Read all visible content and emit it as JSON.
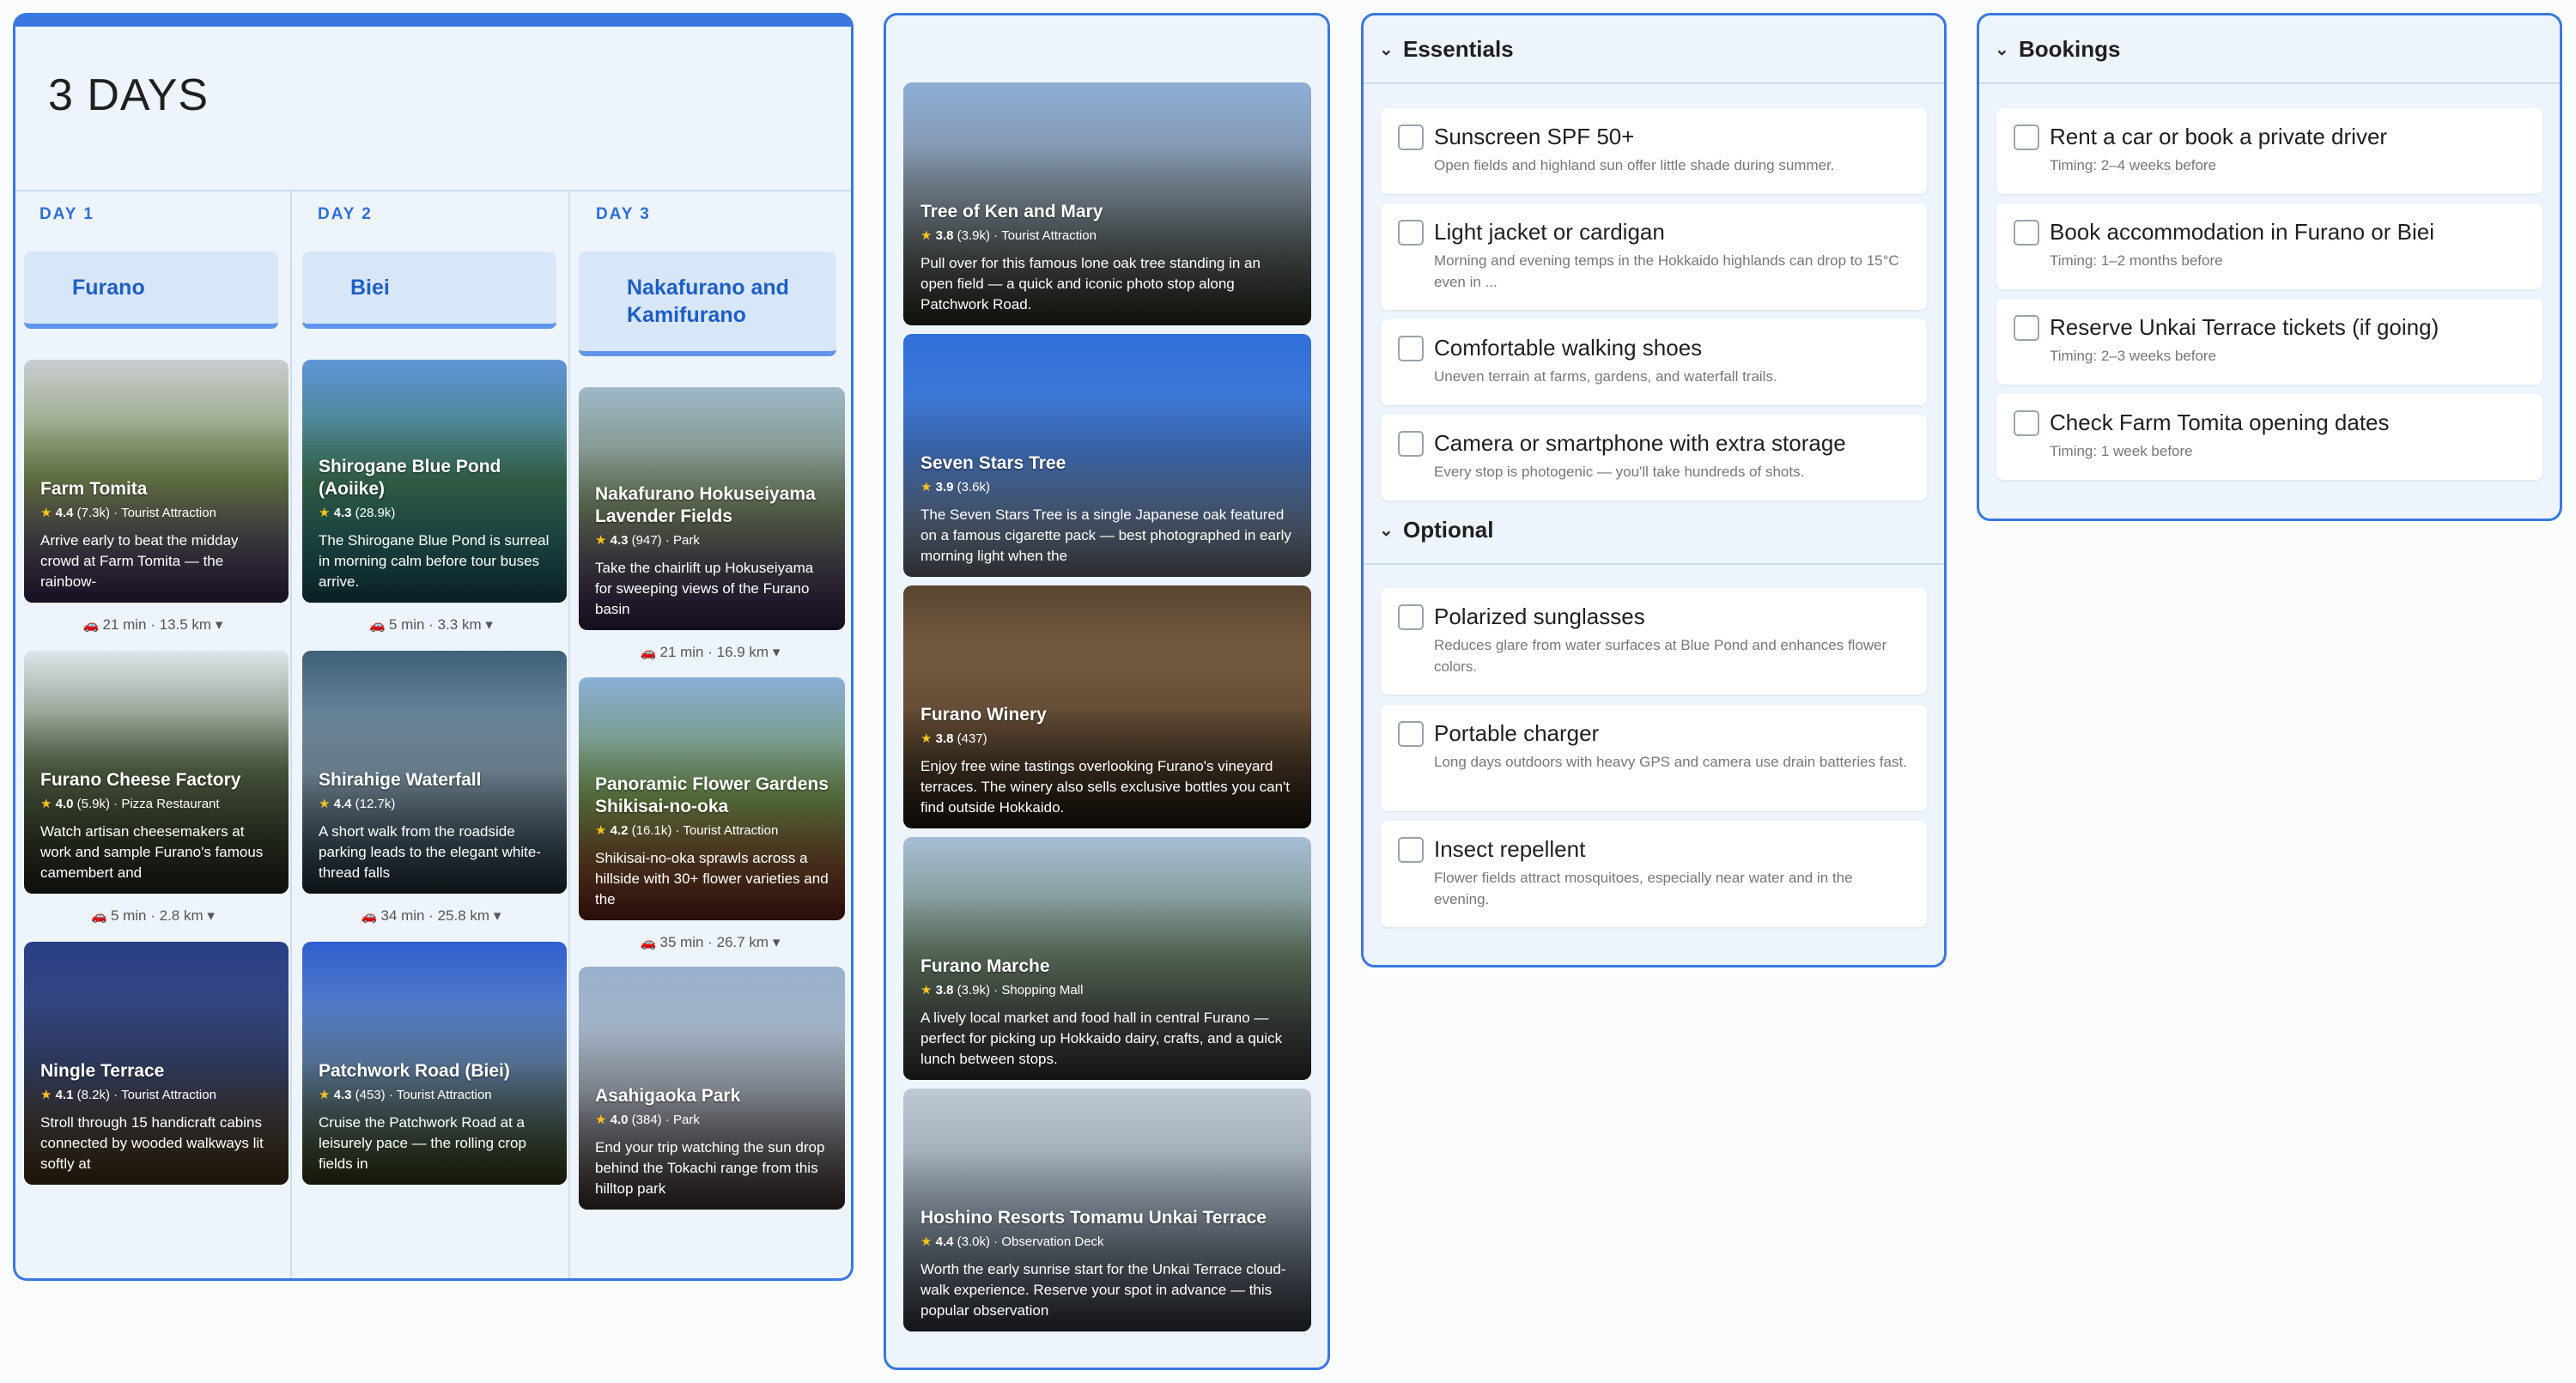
{
  "itinerary": {
    "title": "3 DAYS",
    "days": [
      {
        "label": "DAY 1",
        "location": "Furano",
        "stops": [
          {
            "name": "Farm Tomita",
            "rating": "4.4",
            "reviews": "(7.3k)",
            "category": "Tourist Attraction",
            "description": "Arrive early to beat the midday crowd at Farm Tomita — the rainbow-",
            "colors": [
              "#c8cdd2",
              "#7c8f55",
              "#6a4c9a"
            ]
          },
          {
            "name": "Furano Cheese Factory",
            "rating": "4.0",
            "reviews": "(5.9k)",
            "category": "Pizza Restaurant",
            "description": "Watch artisan cheesemakers at work and sample Furano's famous camembert and",
            "colors": [
              "#dfe5ea",
              "#5a6a4a",
              "#39422f"
            ]
          },
          {
            "name": "Ningle Terrace",
            "rating": "4.1",
            "reviews": "(8.2k)",
            "category": "Tourist Attraction",
            "description": "Stroll through 15 handicraft cabins connected by wooded walkways lit softly at",
            "colors": [
              "#2a3f86",
              "#3b4a7a",
              "#7a5a2a"
            ]
          }
        ],
        "travel": [
          "21 min · 13.5 km",
          "5 min · 2.8 km"
        ]
      },
      {
        "label": "DAY 2",
        "location": "Biei",
        "stops": [
          {
            "name": "Shirogane Blue Pond (Aoiike)",
            "rating": "4.3",
            "reviews": "(28.9k)",
            "category": "",
            "description": "The Shirogane Blue Pond is surreal in morning calm before tour buses arrive.",
            "colors": [
              "#5f95d8",
              "#3f7a5a",
              "#2c8ea0"
            ]
          },
          {
            "name": "Shirahige Waterfall",
            "rating": "4.4",
            "reviews": "(12.7k)",
            "category": "",
            "description": "A short walk from the roadside parking leads to the elegant white-thread falls",
            "colors": [
              "#3f6078",
              "#8aa3b5",
              "#3a5566"
            ]
          },
          {
            "name": "Patchwork Road (Biei)",
            "rating": "4.3",
            "reviews": "(453)",
            "category": "Tourist Attraction",
            "description": "Cruise the Patchwork Road at a leisurely pace — the rolling crop fields in",
            "colors": [
              "#2f5fd0",
              "#6f93c0",
              "#5a6a2a"
            ]
          }
        ],
        "travel": [
          "5 min · 3.3 km",
          "34 min · 25.8 km"
        ]
      },
      {
        "label": "DAY 3",
        "location": "Nakafurano and Kamifurano",
        "stops": [
          {
            "name": "Nakafurano Hokuseiyama Lavender Fields",
            "rating": "4.3",
            "reviews": "(947)",
            "category": "Park",
            "description": "Take the chairlift up Hokuseiyama for sweeping views of the Furano basin",
            "colors": [
              "#9fb9c9",
              "#6e7d5e",
              "#5a3f7f"
            ]
          },
          {
            "name": "Panoramic Flower Gardens Shikisai-no-oka",
            "rating": "4.2",
            "reviews": "(16.1k)",
            "category": "Tourist Attraction",
            "description": "Shikisai-no-oka sprawls across a hillside with 30+ flower varieties and the",
            "colors": [
              "#8ab0d8",
              "#6a8a4a",
              "#b8402a"
            ]
          },
          {
            "name": "Asahigaoka Park",
            "rating": "4.0",
            "reviews": "(384)",
            "category": "Park",
            "description": "End your trip watching the sun drop behind the Tokachi range from this hilltop park",
            "colors": [
              "#9ab2cf",
              "#a9b1bd",
              "#6a5a5a"
            ]
          }
        ],
        "travel": [
          "21 min · 16.9 km",
          "35 min · 26.7 km"
        ]
      }
    ]
  },
  "gallery": [
    {
      "name": "Tree of Ken and Mary",
      "rating": "3.8",
      "reviews": "(3.9k)",
      "category": "Tourist Attraction",
      "description": "Pull over for this famous lone oak tree standing in an open field — a quick and iconic photo stop along Patchwork Road.",
      "colors": [
        "#8eaed6",
        "#7d8a96",
        "#4a4f3a"
      ]
    },
    {
      "name": "Seven Stars Tree",
      "rating": "3.9",
      "reviews": "(3.6k)",
      "category": "",
      "description": "The Seven Stars Tree is a single Japanese oak featured on a famous cigarette pack — best photographed in early morning light when the",
      "colors": [
        "#2f6fd8",
        "#4a80d6",
        "#c0c8d4"
      ]
    },
    {
      "name": "Furano Winery",
      "rating": "3.8",
      "reviews": "(437)",
      "category": "",
      "description": "Enjoy free wine tastings overlooking Furano's vineyard terraces. The winery also sells exclusive bottles you can't find outside Hokkaido.",
      "colors": [
        "#5a4632",
        "#8a6a4a",
        "#3a2c20"
      ]
    },
    {
      "name": "Furano Marche",
      "rating": "3.8",
      "reviews": "(3.9k)",
      "category": "Shopping Mall",
      "description": "A lively local market and food hall in central Furano — perfect for picking up Hokkaido dairy, crafts, and a quick lunch between stops.",
      "colors": [
        "#a6bfd6",
        "#6a7f6a",
        "#5a5a5a"
      ]
    },
    {
      "name": "Hoshino Resorts Tomamu Unkai Terrace",
      "rating": "4.4",
      "reviews": "(3.0k)",
      "category": "Observation Deck",
      "description": "Worth the early sunrise start for the Unkai Terrace cloud-walk experience. Reserve your spot in advance — this popular observation",
      "colors": [
        "#bfc9d4",
        "#8e9aa8",
        "#5a6270"
      ]
    }
  ],
  "packing": {
    "essentials": {
      "title": "Essentials",
      "items": [
        {
          "label": "Sunscreen SPF 50+",
          "note": "Open fields and highland sun offer little shade during summer."
        },
        {
          "label": "Light jacket or cardigan",
          "note": "Morning and evening temps in the Hokkaido highlands can drop to 15°C even in ..."
        },
        {
          "label": "Comfortable walking shoes",
          "note": "Uneven terrain at farms, gardens, and waterfall trails."
        },
        {
          "label": "Camera or smartphone with extra storage",
          "note": "Every stop is photogenic — you'll take hundreds of shots."
        }
      ]
    },
    "optional": {
      "title": "Optional",
      "items": [
        {
          "label": "Polarized sunglasses",
          "note": "Reduces glare from water surfaces at Blue Pond and enhances flower colors."
        },
        {
          "label": "Portable charger",
          "note": "Long days outdoors with heavy GPS and camera use drain batteries fast."
        },
        {
          "label": "Insect repellent",
          "note": "Flower fields attract mosquitoes, especially near water and in the evening."
        }
      ]
    }
  },
  "bookings": {
    "title": "Bookings",
    "items": [
      {
        "label": "Rent a car or book a private driver",
        "note": "Timing: 2–4 weeks before"
      },
      {
        "label": "Book accommodation in Furano or Biei",
        "note": "Timing: 1–2 months before"
      },
      {
        "label": "Reserve Unkai Terrace tickets (if going)",
        "note": "Timing: 2–3 weeks before"
      },
      {
        "label": "Check Farm Tomita opening dates",
        "note": "Timing: 1 week before"
      }
    ]
  },
  "icons": {
    "car": "car-icon",
    "chevron": "chevron-down-icon",
    "star": "star-icon"
  },
  "theme": {
    "accent": "#3a78e0",
    "panel": "#eef4fc",
    "star": "#f7c21c"
  }
}
